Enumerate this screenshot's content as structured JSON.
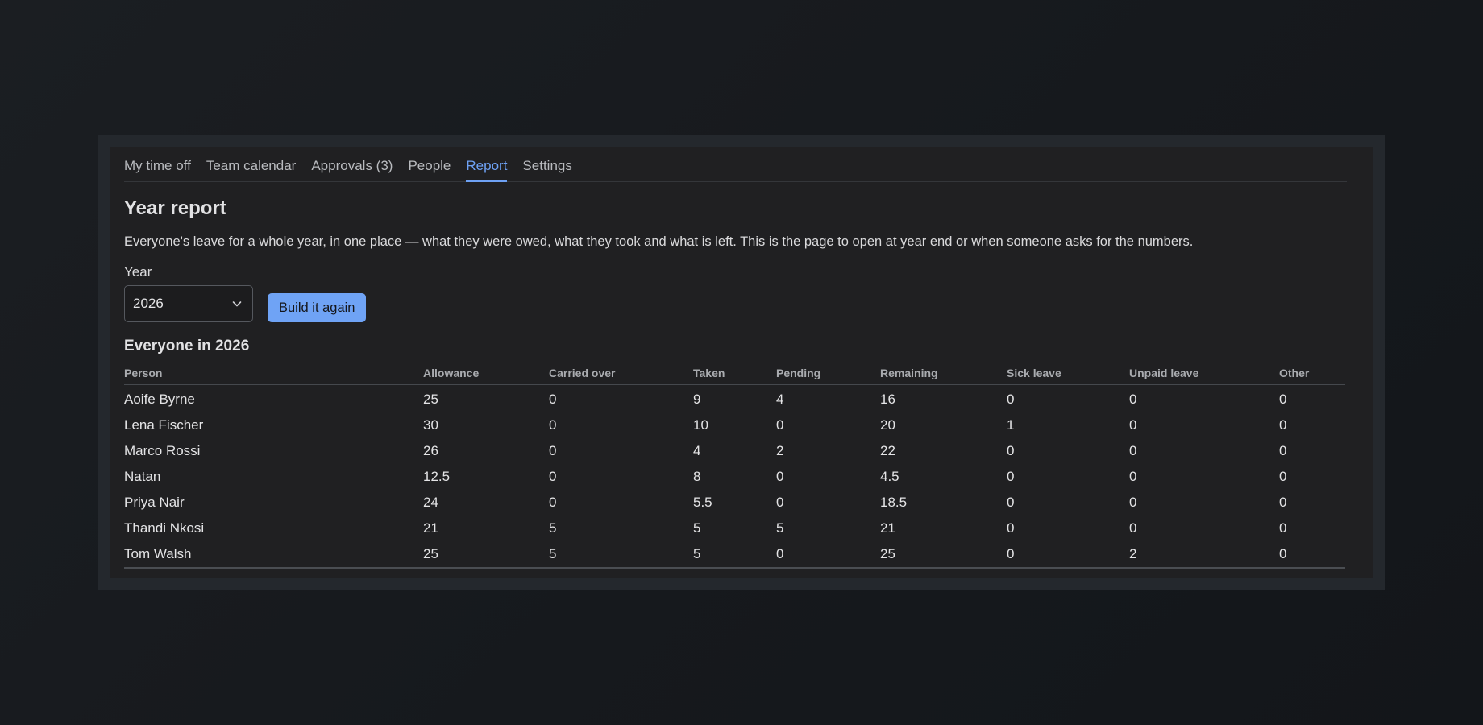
{
  "nav": {
    "tabs": [
      {
        "label": "My time off",
        "active": false
      },
      {
        "label": "Team calendar",
        "active": false
      },
      {
        "label": "Approvals (3)",
        "active": false
      },
      {
        "label": "People",
        "active": false
      },
      {
        "label": "Report",
        "active": true
      },
      {
        "label": "Settings",
        "active": false
      }
    ]
  },
  "page": {
    "title": "Year report",
    "intro": "Everyone's leave for a whole year, in one place — what they were owed, what they took and what is left. This is the page to open at year end or when someone asks for the numbers."
  },
  "controls": {
    "year_label": "Year",
    "year_value": "2026",
    "year_icon": "chevron-down-icon",
    "rebuild_label": "Build it again"
  },
  "report": {
    "title": "Everyone in 2026",
    "columns": [
      "Person",
      "Allowance",
      "Carried over",
      "Taken",
      "Pending",
      "Remaining",
      "Sick leave",
      "Unpaid leave",
      "Other"
    ],
    "rows": [
      [
        "Aoife Byrne",
        "25",
        "0",
        "9",
        "4",
        "16",
        "0",
        "0",
        "0"
      ],
      [
        "Lena Fischer",
        "30",
        "0",
        "10",
        "0",
        "20",
        "1",
        "0",
        "0"
      ],
      [
        "Marco Rossi",
        "26",
        "0",
        "4",
        "2",
        "22",
        "0",
        "0",
        "0"
      ],
      [
        "Natan",
        "12.5",
        "0",
        "8",
        "0",
        "4.5",
        "0",
        "0",
        "0"
      ],
      [
        "Priya Nair",
        "24",
        "0",
        "5.5",
        "0",
        "18.5",
        "0",
        "0",
        "0"
      ],
      [
        "Thandi Nkosi",
        "21",
        "5",
        "5",
        "5",
        "21",
        "0",
        "0",
        "0"
      ],
      [
        "Tom Walsh",
        "25",
        "5",
        "5",
        "0",
        "25",
        "0",
        "2",
        "0"
      ]
    ]
  },
  "colors": {
    "accent": "#6ea1f4",
    "page_background": "#16191d",
    "panel_background": "#202022"
  }
}
